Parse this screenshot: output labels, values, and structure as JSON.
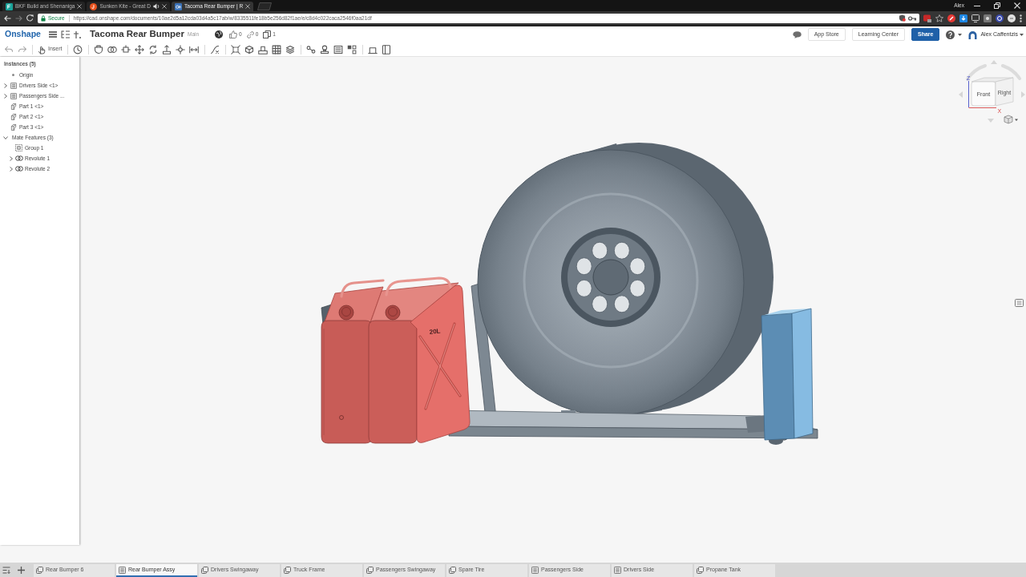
{
  "browser": {
    "tabs": [
      {
        "title": "BKF Build and Shenaniga",
        "selected": false,
        "audio": false
      },
      {
        "title": "Sunken Kite - Great D",
        "selected": false,
        "audio": true
      },
      {
        "title": "Tacoma Rear Bumper | R",
        "selected": true,
        "audio": false
      }
    ],
    "profile": "Alex",
    "secure": "Secure",
    "url": "https://cad.onshape.com/documents/10ae2d5a12cda03d4a5c17ab/w/8335511fe18b5e256d82f1ae/e/c8d4c022caca2546f0aa21df"
  },
  "header": {
    "logo": "Onshape",
    "document_title": "Tacoma Rear Bumper",
    "workspace": "Main",
    "likes": "0",
    "links": "0",
    "versions": "1",
    "buttons": [
      "App Store",
      "Learning Center"
    ],
    "share": "Share",
    "user": "Alex Caffentzis"
  },
  "toolbar": {
    "insert": "Insert"
  },
  "instances": {
    "title": "Instances (5)",
    "items": [
      {
        "label": "Origin",
        "kind": "origin"
      },
      {
        "label": "Drivers Side <1>",
        "kind": "assembly",
        "expanded": false
      },
      {
        "label": "Passengers Side ...",
        "kind": "assembly",
        "expanded": false
      },
      {
        "label": "Part 1 <1>",
        "kind": "part"
      },
      {
        "label": "Part 2 <1>",
        "kind": "part"
      },
      {
        "label": "Part 3 <1>",
        "kind": "part"
      },
      {
        "label": "Mate Features (3)",
        "kind": "folder",
        "expanded": true,
        "children": [
          {
            "label": "Group 1",
            "kind": "group"
          },
          {
            "label": "Revolute 1",
            "kind": "revolute",
            "expanded": false
          },
          {
            "label": "Revolute 2",
            "kind": "revolute",
            "expanded": false
          }
        ]
      }
    ]
  },
  "viewport": {
    "can_label": "20L",
    "view_cube": {
      "front": "Front",
      "right": "Right",
      "z_axis": "Z",
      "x_axis": "X"
    }
  },
  "tabs": [
    {
      "label": "Rear Bumper 6",
      "kind": "part_studio",
      "selected": false
    },
    {
      "label": "Rear Bumper Assy",
      "kind": "assembly",
      "selected": true
    },
    {
      "label": "Drivers Swingaway",
      "kind": "part_studio",
      "selected": false
    },
    {
      "label": "Truck Frame",
      "kind": "part_studio",
      "selected": false
    },
    {
      "label": "Passengers Swingaway",
      "kind": "part_studio",
      "selected": false
    },
    {
      "label": "Spare Tire",
      "kind": "part_studio",
      "selected": false
    },
    {
      "label": "Passengers Side",
      "kind": "assembly",
      "selected": false
    },
    {
      "label": "Drivers Side",
      "kind": "assembly",
      "selected": false
    },
    {
      "label": "Propane Tank",
      "kind": "part_studio",
      "selected": false
    }
  ]
}
